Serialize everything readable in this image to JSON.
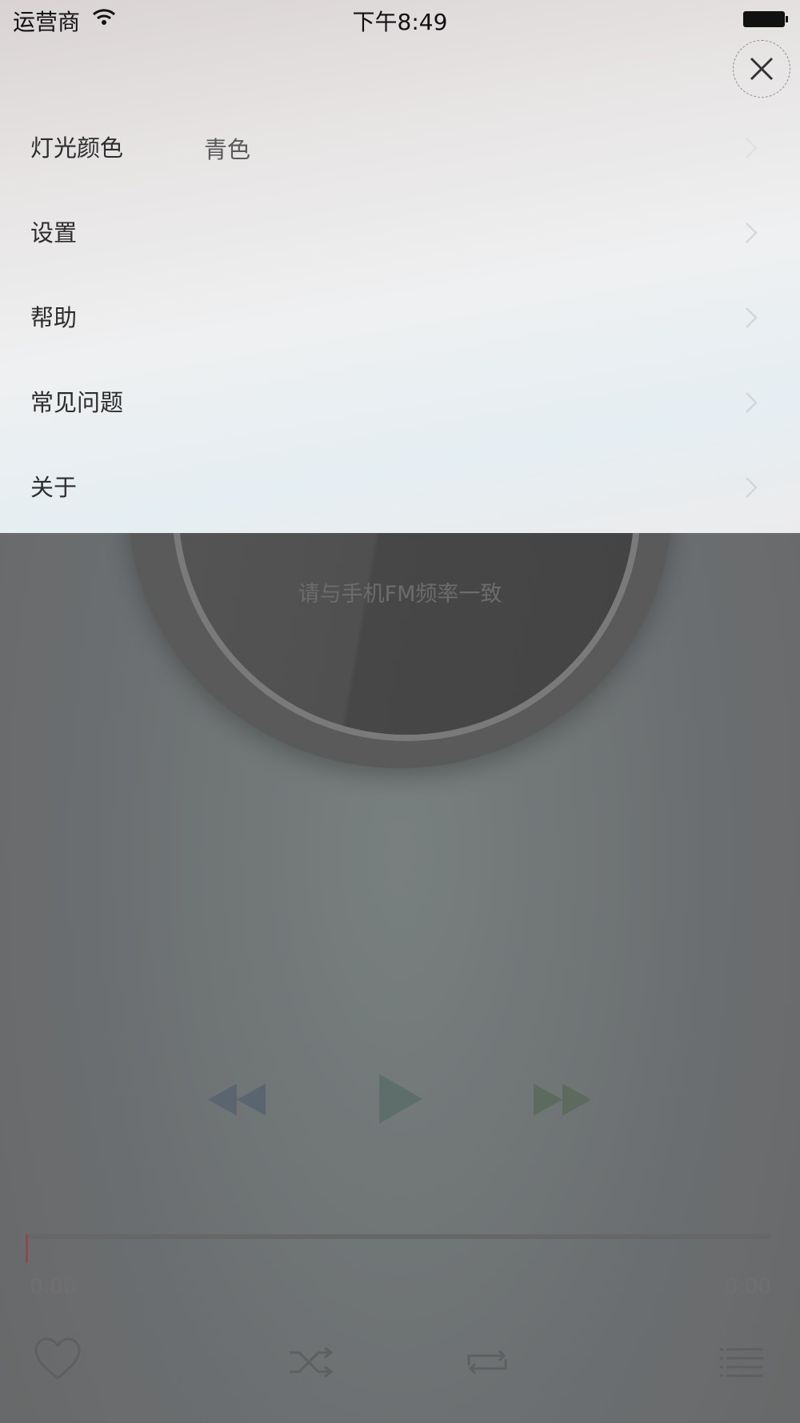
{
  "status_bar": {
    "carrier": "运营商",
    "time": "下午8:49"
  },
  "menu": {
    "items": [
      {
        "label": "灯光颜色",
        "value": "青色"
      },
      {
        "label": "设置",
        "value": ""
      },
      {
        "label": "帮助",
        "value": ""
      },
      {
        "label": "常见问题",
        "value": ""
      },
      {
        "label": "关于",
        "value": ""
      }
    ]
  },
  "player": {
    "disc_caption": "请与手机FM频率一致",
    "time_current": "0:00",
    "time_total": "0:00"
  },
  "icons": {
    "close": "close-icon",
    "chevron": "chevron-right-icon",
    "rewind": "rewind-icon",
    "play": "play-icon",
    "fast_forward": "fast-forward-icon",
    "heart": "heart-icon",
    "shuffle": "shuffle-icon",
    "repeat": "repeat-icon",
    "playlist": "playlist-icon"
  }
}
